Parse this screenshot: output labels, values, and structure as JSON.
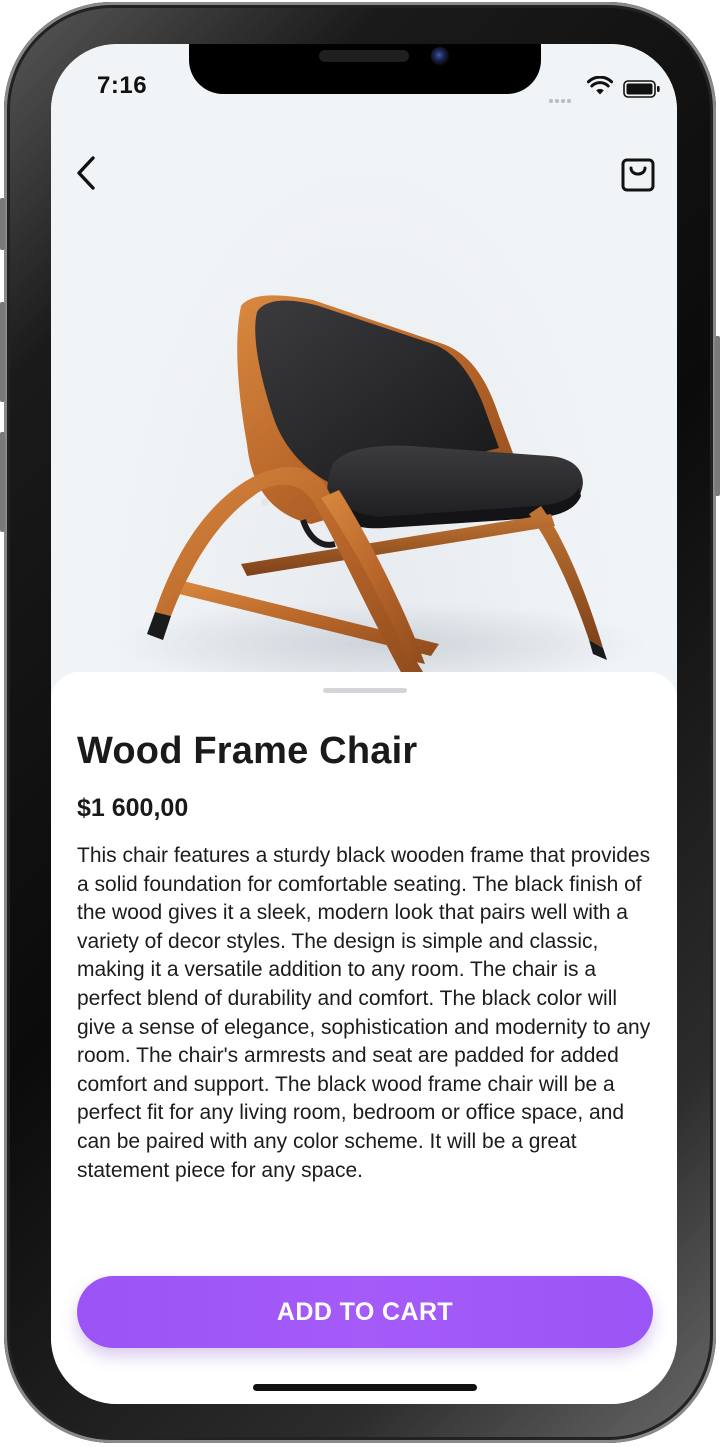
{
  "status_bar": {
    "time": "7:16"
  },
  "nav": {
    "back_icon": "chevron-left-icon",
    "cart_icon": "shopping-bag-icon"
  },
  "product": {
    "image_subject": "wood-frame-chair",
    "title": "Wood Frame Chair",
    "price": "$1 600,00",
    "description": "This chair features a sturdy black wooden frame that provides a solid foundation for comfortable seating. The black finish of the wood gives it a sleek, modern look that pairs well with a variety of decor styles. The design is simple and classic, making it a versatile addition to any room. The chair is a perfect blend of durability and comfort. The black color will give a sense of elegance, sophistication and modernity to any room. The chair's armrests and seat are padded for added comfort and support. The black wood frame chair will be a perfect fit for any living room, bedroom or office space, and can be paired with any color scheme. It will be a great statement piece for any space."
  },
  "actions": {
    "add_to_cart_label": "ADD TO CART"
  },
  "colors": {
    "accent": "#a259f7",
    "background": "#f1f4f7",
    "sheet": "#ffffff",
    "text": "#1a1a1a"
  }
}
